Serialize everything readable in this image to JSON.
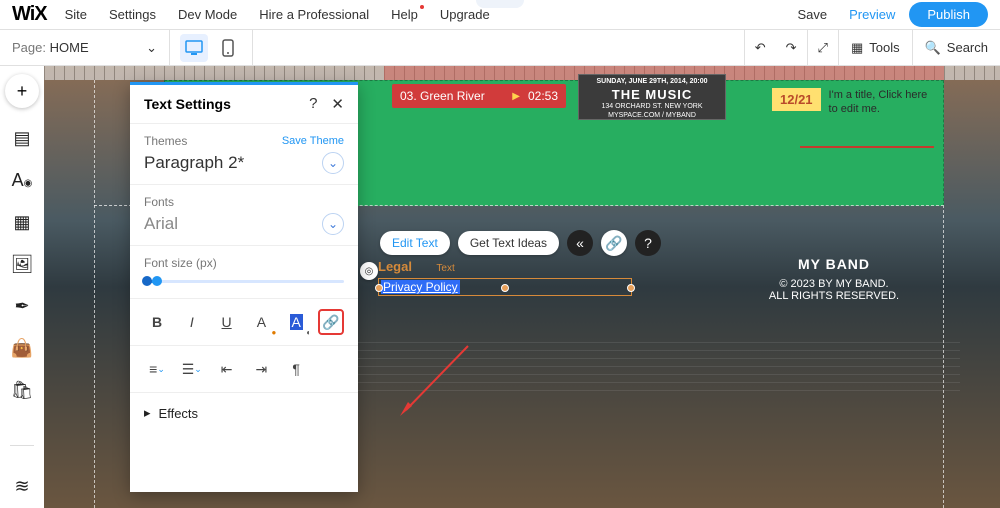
{
  "topbar": {
    "logo": "WiX",
    "menu": [
      "Site",
      "Settings",
      "Dev Mode",
      "Hire a Professional",
      "Help",
      "Upgrade"
    ],
    "save": "Save",
    "preview": "Preview",
    "publish": "Publish"
  },
  "secondbar": {
    "page_prefix": "Page:",
    "page_name": "HOME",
    "tools": "Tools",
    "search": "Search"
  },
  "panel": {
    "title": "Text Settings",
    "themes_label": "Themes",
    "save_theme": "Save Theme",
    "theme_value": "Paragraph 2*",
    "fonts_label": "Fonts",
    "font_value": "Arial",
    "fontsize_label": "Font size (px)",
    "effects": "Effects",
    "link_tooltip": "Link"
  },
  "canvas": {
    "track_no": "03.",
    "track_name": "Green River",
    "track_dur": "02:53",
    "music": {
      "line1": "SUNDAY, JUNE 29TH, 2014, 20:00",
      "big": "THE MUSIC",
      "addr": "134 ORCHARD ST.  NEW YORK",
      "site": "MYSPACE.COM / MYBAND"
    },
    "event": {
      "date": "12/21",
      "text": "I'm a title, Click here to edit me."
    },
    "toolbar": {
      "edit": "Edit Text",
      "ideas": "Get Text Ideas"
    },
    "legal": {
      "heading": "Legal",
      "sub": "Text",
      "link": "Privacy Policy"
    },
    "band": {
      "name": "MY BAND",
      "copy": "© 2023 BY MY BAND.",
      "rights": "ALL RIGHTS RESERVED."
    }
  }
}
